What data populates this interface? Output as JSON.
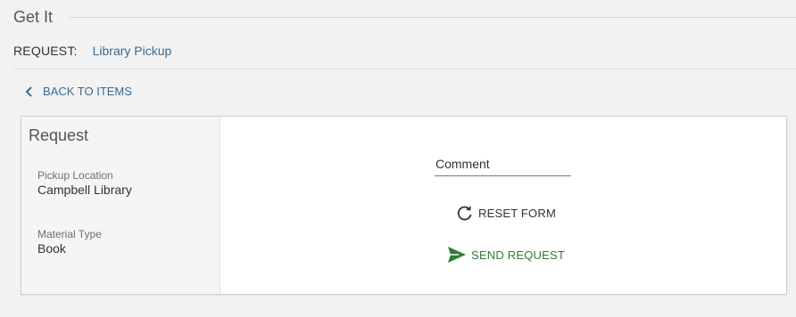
{
  "section": {
    "title": "Get It"
  },
  "request": {
    "label": "REQUEST:",
    "type": "Library Pickup"
  },
  "back_link": {
    "label": "BACK TO ITEMS",
    "icon": "chevron-left-icon"
  },
  "summary": {
    "title": "Request",
    "fields": [
      {
        "label": "Pickup Location",
        "value": "Campbell Library"
      },
      {
        "label": "Material Type",
        "value": "Book"
      }
    ]
  },
  "form": {
    "comment_label": "Comment",
    "reset_label": "RESET FORM",
    "reset_icon": "refresh-icon",
    "send_label": "SEND REQUEST",
    "send_icon": "send-icon"
  },
  "colors": {
    "link": "#3a6a8e",
    "send": "#2e7d32",
    "background": "#f2f2f2"
  }
}
